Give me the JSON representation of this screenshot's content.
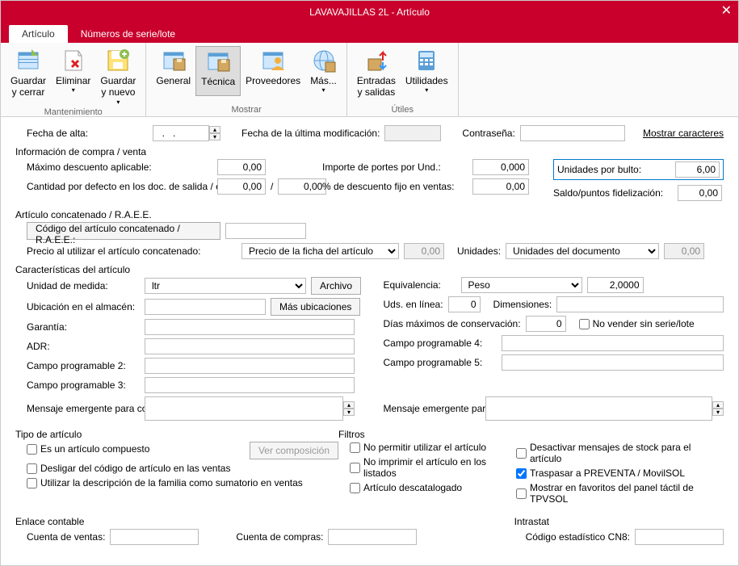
{
  "window": {
    "title": "LAVAVAJILLAS 2L - Artículo"
  },
  "tabs": {
    "articulo": "Artículo",
    "serial": "Números de serie/lote"
  },
  "ribbon": {
    "guardar_cerrar": "Guardar\ny cerrar",
    "eliminar": "Eliminar",
    "guardar_nuevo": "Guardar\ny nuevo",
    "general": "General",
    "tecnica": "Técnica",
    "proveedores": "Proveedores",
    "mas": "Más...",
    "entradas_salidas": "Entradas\ny salidas",
    "utilidades": "Utilidades",
    "group_mant": "Mantenimiento",
    "group_mostrar": "Mostrar",
    "group_utiles": "Útiles"
  },
  "top": {
    "fecha_alta_lbl": "Fecha de alta:",
    "fecha_alta_val": "  .   .    ",
    "fecha_mod_lbl": "Fecha de la última modificación:",
    "fecha_mod_val": "",
    "contrasena_lbl": "Contraseña:",
    "contrasena_val": "",
    "mostrar_chars": "Mostrar caracteres"
  },
  "compra_venta": {
    "header": "Información de compra / venta",
    "max_desc_lbl": "Máximo descuento aplicable:",
    "max_desc_val": "0,00",
    "cant_def_lbl": "Cantidad por defecto en los doc. de salida / entrada:",
    "cant_def_a": "0,00",
    "cant_def_sep": "/",
    "cant_def_b": "0,00",
    "importe_portes_lbl": "Importe de portes por Und.:",
    "importe_portes_val": "0,000",
    "pct_desc_lbl": "% de descuento fijo en ventas:",
    "pct_desc_val": "0,00",
    "und_bulto_lbl": "Unidades por bulto:",
    "und_bulto_val": "6,00",
    "saldo_lbl": "Saldo/puntos fidelización:",
    "saldo_val": "0,00"
  },
  "concat": {
    "header": "Artículo concatenado / R.A.E.E.",
    "codigo_lbl": "Código del artículo concatenado / R.A.E.E.:",
    "codigo_val": "",
    "precio_lbl": "Precio al utilizar el artículo concatenado:",
    "precio_sel": "Precio de la ficha del artículo",
    "precio_val": "0,00",
    "unidades_lbl": "Unidades:",
    "unidades_sel": "Unidades del documento",
    "unidades_val": "0,00"
  },
  "caract": {
    "header": "Características del artículo",
    "um_lbl": "Unidad de medida:",
    "um_val": "ltr",
    "archivo_btn": "Archivo",
    "equiv_lbl": "Equivalencia:",
    "equiv_sel": "Peso",
    "equiv_val": "2,0000",
    "ubic_lbl": "Ubicación en el almacén:",
    "ubic_val": "",
    "mas_ubic_btn": "Más ubicaciones",
    "uds_linea_lbl": "Uds. en línea:",
    "uds_linea_val": "0",
    "dim_lbl": "Dimensiones:",
    "dim_val": "",
    "garantia_lbl": "Garantía:",
    "garantia_val": "",
    "dias_max_lbl": "Días máximos de conservación:",
    "dias_max_val": "0",
    "no_vender_lbl": "No vender sin serie/lote",
    "adr_lbl": "ADR:",
    "adr_val": "",
    "cp4_lbl": "Campo programable 4:",
    "cp4_val": "",
    "cp2_lbl": "Campo programable 2:",
    "cp2_val": "",
    "cp5_lbl": "Campo programable 5:",
    "cp5_val": "",
    "cp3_lbl": "Campo programable 3:",
    "cp3_val": "",
    "msg_compras_lbl": "Mensaje emergente para compras:",
    "msg_compras_val": "",
    "msg_ventas_lbl": "Mensaje emergente para ventas:",
    "msg_ventas_val": ""
  },
  "tipo": {
    "header": "Tipo de artículo",
    "compuesto": "Es un artículo compuesto",
    "ver_comp_btn": "Ver composición",
    "desligar": "Desligar del código de artículo en las ventas",
    "usar_desc_fam": "Utilizar la descripción de la familia como sumatorio en ventas"
  },
  "filtros": {
    "header": "Filtros",
    "no_permitir": "No permitir utilizar el artículo",
    "no_imprimir": "No imprimir el artículo en los listados",
    "descatalogado": "Artículo descatalogado",
    "desact_stock": "Desactivar mensajes de stock para el artículo",
    "traspasar": "Traspasar a PREVENTA / MovilSOL",
    "favoritos": "Mostrar en favoritos del panel táctil de TPVSOL"
  },
  "enlace": {
    "header": "Enlace contable",
    "cta_ventas_lbl": "Cuenta de ventas:",
    "cta_ventas_val": "",
    "cta_compras_lbl": "Cuenta de compras:",
    "cta_compras_val": ""
  },
  "intrastat": {
    "header": "Intrastat",
    "cn8_lbl": "Código estadístico CN8:",
    "cn8_val": ""
  }
}
